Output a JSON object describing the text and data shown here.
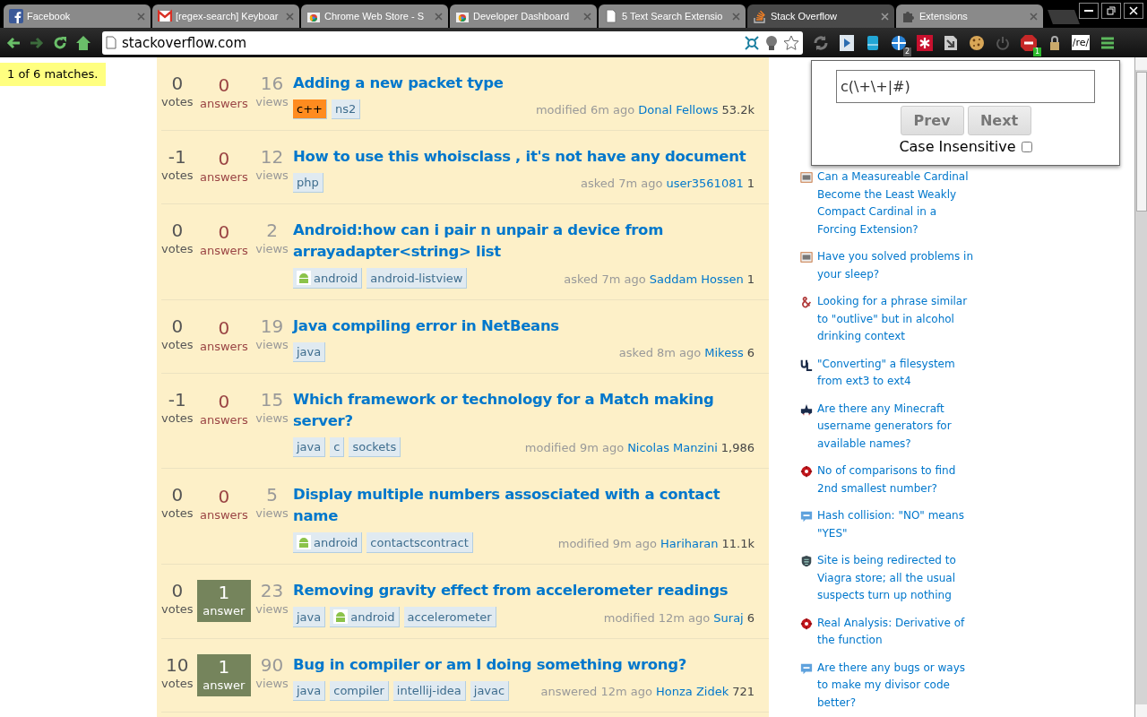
{
  "tabs": [
    {
      "title": "Facebook",
      "kind": "facebook",
      "selected": false
    },
    {
      "title": "[regex-search] Keyboar",
      "kind": "gmail",
      "selected": false
    },
    {
      "title": "Chrome Web Store - S",
      "kind": "store",
      "selected": false
    },
    {
      "title": "Developer Dashboard",
      "kind": "store",
      "selected": false
    },
    {
      "title": "5 Text Search Extensio",
      "kind": "page",
      "selected": false
    },
    {
      "title": "Stack Overflow",
      "kind": "stack",
      "selected": true
    },
    {
      "title": "Extensions",
      "kind": "puzzle",
      "selected": false
    }
  ],
  "address": "stackoverflow.com",
  "extensions": [
    {
      "kind": "sync"
    },
    {
      "kind": "play"
    },
    {
      "kind": "drive"
    },
    {
      "kind": "cross",
      "badge": "2"
    },
    {
      "kind": "lastpass"
    },
    {
      "kind": "arrow"
    },
    {
      "kind": "cookie"
    },
    {
      "kind": "power"
    },
    {
      "kind": "abp",
      "badge": "1"
    },
    {
      "kind": "lock"
    },
    {
      "kind": "text",
      "label": "/re/"
    }
  ],
  "match_status": "1 of 6 matches.",
  "questions": [
    {
      "votes": "0",
      "votes_label": "votes",
      "answers": "0",
      "answers_label": "answers",
      "answered": false,
      "views": "16",
      "views_label": "views",
      "title": "Adding a new packet type",
      "tags": [
        {
          "name": "c++",
          "kind": "plain",
          "highlighted": true
        },
        {
          "name": "ns2",
          "kind": "plain",
          "highlighted": false
        }
      ],
      "action": "modified 6m ago",
      "user": "Donal Fellows",
      "rep": "53.2k"
    },
    {
      "votes": "-1",
      "votes_label": "votes",
      "answers": "0",
      "answers_label": "answers",
      "answered": false,
      "views": "12",
      "views_label": "views",
      "title": "How to use this whoisclass , it's not have any document",
      "tags": [
        {
          "name": "php",
          "kind": "plain",
          "highlighted": false
        }
      ],
      "action": "asked 7m ago",
      "user": "user3561081",
      "rep": "1"
    },
    {
      "votes": "0",
      "votes_label": "votes",
      "answers": "0",
      "answers_label": "answers",
      "answered": false,
      "views": "2",
      "views_label": "views",
      "title": "Android:how can i pair n unpair a device from arrayadapter<string> list",
      "tags": [
        {
          "name": "android",
          "kind": "icon",
          "highlighted": false
        },
        {
          "name": "android-listview",
          "kind": "plain",
          "highlighted": false
        }
      ],
      "action": "asked 7m ago",
      "user": "Saddam Hossen",
      "rep": "1"
    },
    {
      "votes": "0",
      "votes_label": "votes",
      "answers": "0",
      "answers_label": "answers",
      "answered": false,
      "views": "19",
      "views_label": "views",
      "title": "Java compiling error in NetBeans",
      "tags": [
        {
          "name": "java",
          "kind": "plain",
          "highlighted": false
        }
      ],
      "action": "asked 8m ago",
      "user": "Mikess",
      "rep": "6"
    },
    {
      "votes": "-1",
      "votes_label": "votes",
      "answers": "0",
      "answers_label": "answers",
      "answered": false,
      "views": "15",
      "views_label": "views",
      "title": "Which framework or technology for a Match making server?",
      "tags": [
        {
          "name": "java",
          "kind": "plain",
          "highlighted": false
        },
        {
          "name": "c",
          "kind": "plain",
          "highlighted": false
        },
        {
          "name": "sockets",
          "kind": "plain",
          "highlighted": false
        }
      ],
      "action": "modified 9m ago",
      "user": "Nicolas Manzini",
      "rep": "1,986"
    },
    {
      "votes": "0",
      "votes_label": "votes",
      "answers": "0",
      "answers_label": "answers",
      "answered": false,
      "views": "5",
      "views_label": "views",
      "title": "Display multiple numbers assosciated with a contact name",
      "tags": [
        {
          "name": "android",
          "kind": "icon",
          "highlighted": false
        },
        {
          "name": "contactscontract",
          "kind": "plain",
          "highlighted": false
        }
      ],
      "action": "modified 9m ago",
      "user": "Hariharan",
      "rep": "11.1k"
    },
    {
      "votes": "0",
      "votes_label": "votes",
      "answers": "1",
      "answers_label": "answer",
      "answered": true,
      "views": "23",
      "views_label": "views",
      "title": "Removing gravity effect from accelerometer readings",
      "tags": [
        {
          "name": "java",
          "kind": "plain",
          "highlighted": false
        },
        {
          "name": "android",
          "kind": "icon",
          "highlighted": false
        },
        {
          "name": "accelerometer",
          "kind": "plain",
          "highlighted": false
        }
      ],
      "action": "modified 12m ago",
      "user": "Suraj",
      "rep": "6"
    },
    {
      "votes": "10",
      "votes_label": "votes",
      "answers": "1",
      "answers_label": "answer",
      "answered": true,
      "views": "90",
      "views_label": "views",
      "title": "Bug in compiler or am I doing something wrong?",
      "tags": [
        {
          "name": "java",
          "kind": "plain",
          "highlighted": false
        },
        {
          "name": "compiler",
          "kind": "plain",
          "highlighted": false
        },
        {
          "name": "intellij-idea",
          "kind": "plain",
          "highlighted": false
        },
        {
          "name": "javac",
          "kind": "plain",
          "highlighted": false
        }
      ],
      "action": "answered 12m ago",
      "user": "Honza Zidek",
      "rep": "721"
    }
  ],
  "hot_questions": [
    {
      "kind": "mo",
      "title": "Can a Measureable Cardinal Become the Least Weakly Compact Cardinal in a Forcing Extension?"
    },
    {
      "kind": "mo",
      "title": "Have you solved problems in your sleep?"
    },
    {
      "kind": "ell",
      "title": "Looking for a phrase similar to \"outlive\" but in alcohol drinking context"
    },
    {
      "kind": "ul",
      "title": "\"Converting\" a filesystem from ext3 to ext4"
    },
    {
      "kind": "gaming",
      "title": "Are there any Minecraft username generators for available names?"
    },
    {
      "kind": "math",
      "title": "No of comparisons to find 2nd smallest number?"
    },
    {
      "kind": "bubble",
      "title": "Hash collision: \"NO\" means \"YES\""
    },
    {
      "kind": "shield",
      "title": "Site is being redirected to Viagra store; all the usual suspects turn up nothing"
    },
    {
      "kind": "math",
      "title": "Real Analysis: Derivative of the function"
    },
    {
      "kind": "bubble",
      "title": "Are there any bugs or ways to make my divisor code better?"
    }
  ],
  "search_popup": {
    "query": "c(\\+\\+|#)",
    "buttons": [
      {
        "label": "Prev",
        "disabled": true
      },
      {
        "label": "Next",
        "disabled": true
      }
    ],
    "case_label": "Case Insensitive",
    "case_insensitive": false
  }
}
